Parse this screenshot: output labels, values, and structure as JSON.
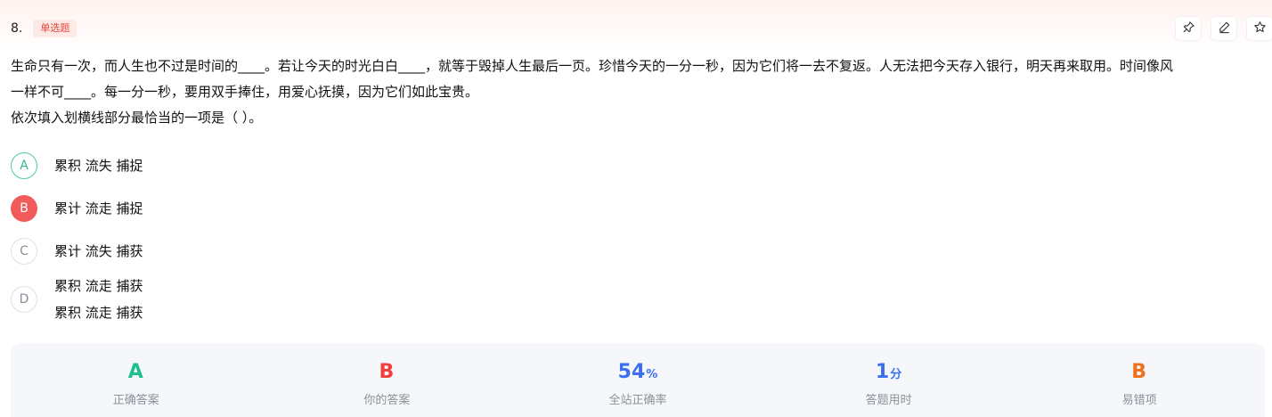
{
  "question": {
    "number": "8.",
    "type": "单选题",
    "stem_lines": [
      "生命只有一次，而人生也不过是时间的____。若让今天的时光白白____，就等于毁掉人生最后一页。珍惜今天的一分一秒，因为它们将一去不复返。人无法把今天存入银行，明天再来取用。时间像风",
      "一样不可____。每一分一秒，要用双手捧住，用爱心抚摸，因为它们如此宝贵。",
      "依次填入划横线部分最恰当的一项是（ ）。"
    ]
  },
  "toolbar": {
    "icons": [
      "pin-icon",
      "edit-icon",
      "star-icon"
    ]
  },
  "options": [
    {
      "letter": "A",
      "text": "累积 流失 捕捉",
      "state": "correct"
    },
    {
      "letter": "B",
      "text": "累计 流走 捕捉",
      "state": "selected-wrong"
    },
    {
      "letter": "C",
      "text": "累计 流失 捕获",
      "state": "normal"
    },
    {
      "letter": "D",
      "text": "累积 流走 捕获",
      "text_repeat": "累积 流走 捕获",
      "state": "normal"
    }
  ],
  "stats": [
    {
      "value": "A",
      "unit": "",
      "label": "正确答案",
      "color": "#1fbe8f"
    },
    {
      "value": "B",
      "unit": "",
      "label": "你的答案",
      "color": "#f0403c"
    },
    {
      "value": "54",
      "unit": "%",
      "label": "全站正确率",
      "color": "#3b6ef0"
    },
    {
      "value": "1",
      "unit": "分",
      "label": "答题用时",
      "color": "#3b6ef0"
    },
    {
      "value": "B",
      "unit": "",
      "label": "易错项",
      "color": "#f0701e"
    }
  ],
  "colors": {
    "accent_correct": "#4cc9a0",
    "accent_wrong": "#f25b5b",
    "tag_red": "#e5473a"
  }
}
